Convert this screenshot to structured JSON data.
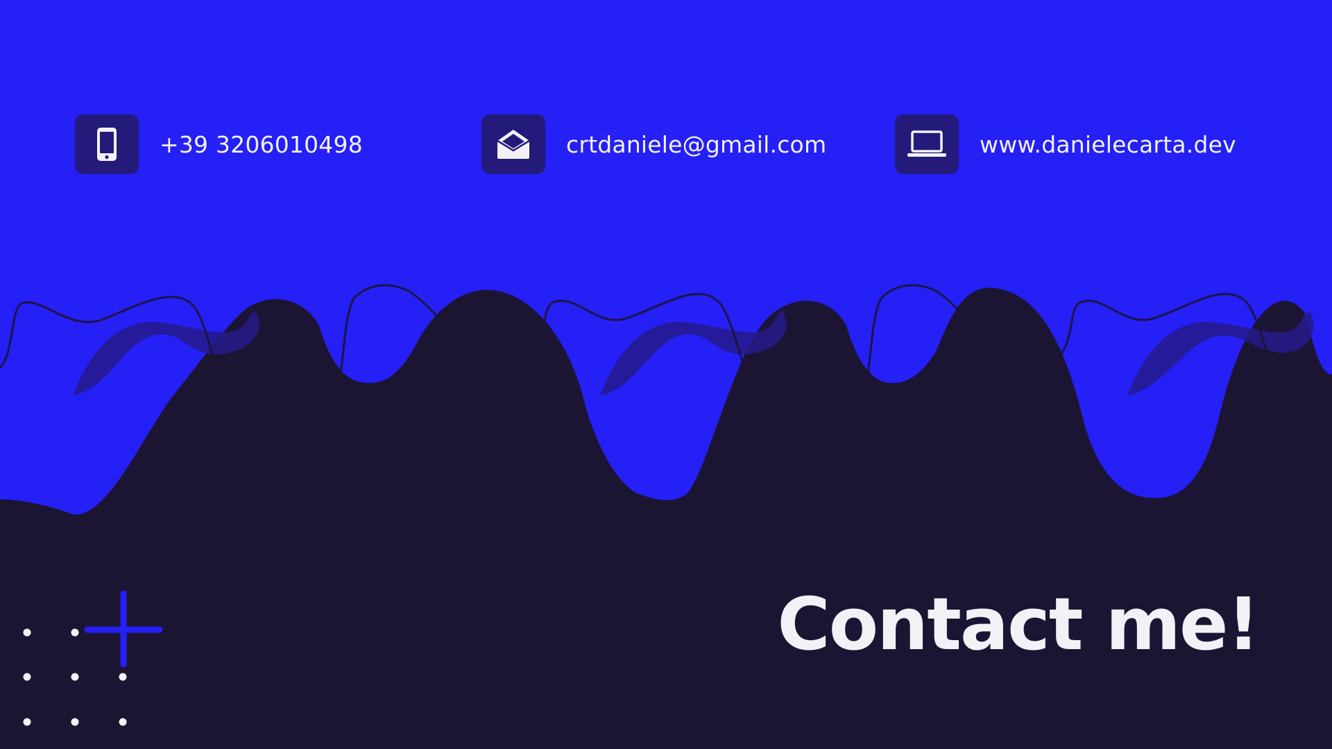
{
  "colors": {
    "top_background": "#2520f5",
    "bottom_background": "#1c1433",
    "icon_tile": "#231a7a",
    "wave_accent": "#261a8a",
    "text_light": "#f2f2f6",
    "plus_accent": "#2520f5",
    "dot_color": "#f2f2f6"
  },
  "contacts": [
    {
      "icon": "phone-icon",
      "text": "+39 3206010498"
    },
    {
      "icon": "envelope-icon",
      "text": "crtdaniele@gmail.com"
    },
    {
      "icon": "laptop-icon",
      "text": "www.danielecarta.dev"
    }
  ],
  "headline": "Contact me!"
}
